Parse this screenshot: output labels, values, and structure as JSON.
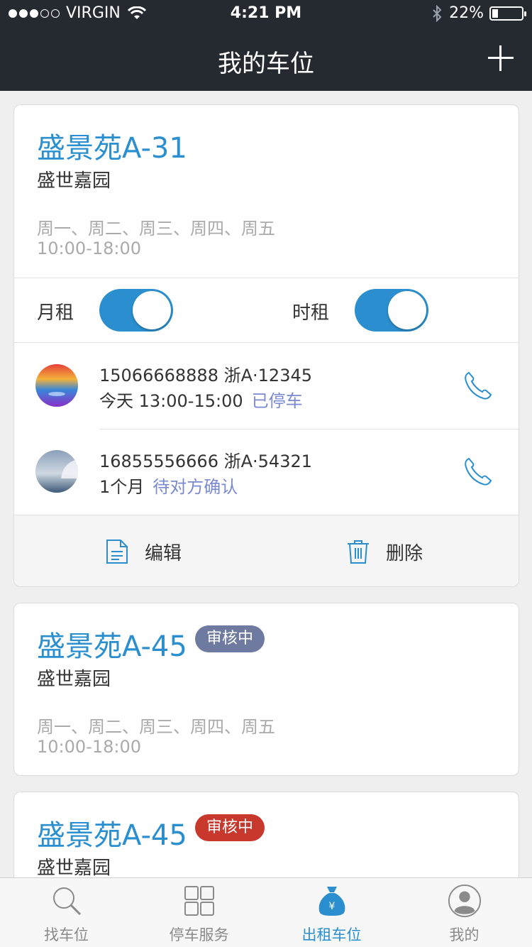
{
  "status_bar": {
    "carrier": "VIRGIN",
    "time": "4:21 PM",
    "battery": "22%",
    "battery_level": 0.22
  },
  "nav": {
    "title": "我的车位",
    "add_icon": "plus-icon"
  },
  "cards": [
    {
      "name": "盛景苑A-31",
      "community": "盛世嘉园",
      "days": "周一、周二、周三、周四、周五",
      "hours": "10:00-18:00",
      "monthly_label": "月租",
      "monthly_on": true,
      "hourly_label": "时租",
      "hourly_on": true,
      "renters": [
        {
          "phone": "15066668888",
          "plate": "浙A·12345",
          "period": "今天 13:00-15:00",
          "status": "已停车"
        },
        {
          "phone": "16855556666",
          "plate": "浙A·54321",
          "period": "1个月",
          "status": "待对方确认"
        }
      ],
      "edit_label": "编辑",
      "delete_label": "删除"
    },
    {
      "name": "盛景苑A-45",
      "badge": "审核中",
      "badge_color": "#6e7aa0",
      "community": "盛世嘉园",
      "days": "周一、周二、周三、周四、周五",
      "hours": "10:00-18:00"
    },
    {
      "name": "盛景苑A-45",
      "badge": "审核中",
      "badge_color": "#c9382c",
      "community": "盛世嘉园"
    }
  ],
  "tabbar": {
    "items": [
      {
        "label": "找车位",
        "icon": "search-icon"
      },
      {
        "label": "停车服务",
        "icon": "grid-icon"
      },
      {
        "label": "出租车位",
        "icon": "money-bag-icon",
        "active": true
      },
      {
        "label": "我的",
        "icon": "user-icon"
      }
    ]
  },
  "colors": {
    "accent": "#2b8fcf",
    "nav_bg": "#252a31",
    "status_link": "#7a8ad0"
  }
}
